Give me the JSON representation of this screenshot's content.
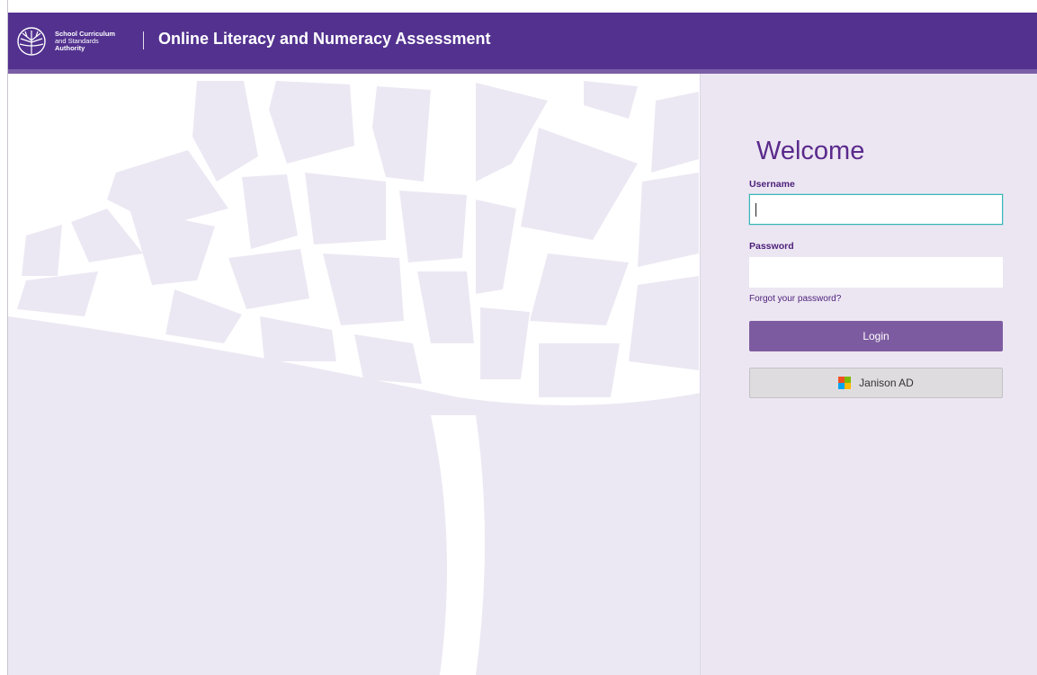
{
  "header": {
    "logo_lines": [
      "School Curriculum",
      "and Standards",
      "Authority"
    ],
    "app_title": "Online Literacy and Numeracy Assessment"
  },
  "login": {
    "welcome": "Welcome",
    "username_label": "Username",
    "username_value": "",
    "password_label": "Password",
    "password_value": "",
    "forgot_link": "Forgot your password?",
    "login_button": "Login",
    "sso_button": "Janison AD"
  },
  "icons": {
    "logo": "scsa-tree-logo-icon",
    "sso": "microsoft-logo-icon",
    "background": "tree-watermark"
  },
  "colors": {
    "header_bg": "#52318f",
    "header_accent": "#7a5fa6",
    "panel_bg": "#ece6f2",
    "welcome_text": "#5a2a8c",
    "login_button": "#7d5ba0",
    "sso_button": "#dedcdf",
    "focus_border": "#37b6b9",
    "microsoft": [
      "#f25022",
      "#7fba00",
      "#00a4ef",
      "#ffb900"
    ]
  }
}
